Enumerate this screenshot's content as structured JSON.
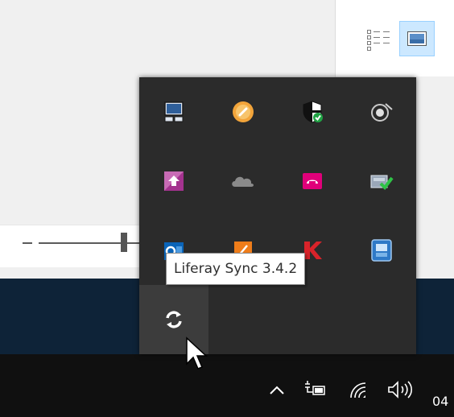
{
  "window": {
    "toolbar_buttons": [
      {
        "name": "details-view",
        "icon": "details-list-icon",
        "selected": false
      },
      {
        "name": "large-icons-view",
        "icon": "picture-frame-icon",
        "selected": true
      }
    ],
    "zoom_slider": {
      "value_fraction": 0.85
    }
  },
  "tray_overflow": {
    "icons": [
      {
        "icon": "touchpad-monitor-icon"
      },
      {
        "icon": "orange-disc-icon"
      },
      {
        "icon": "security-shield-check-icon"
      },
      {
        "icon": "speaker-icon"
      },
      {
        "icon": "purple-upload-icon"
      },
      {
        "icon": "onedrive-cloud-icon"
      },
      {
        "icon": "pink-phone-icon"
      },
      {
        "icon": "green-check-card-icon"
      },
      {
        "icon": "outlook-icon"
      },
      {
        "icon": "orange-app-icon"
      },
      {
        "icon": "red-k-icon"
      },
      {
        "icon": "blue-network-icon"
      },
      {
        "icon": "liferay-sync-icon",
        "hovered": true
      }
    ]
  },
  "tooltip": {
    "text": "Liferay Sync 3.4.2"
  },
  "taskbar": {
    "tray": [
      {
        "icon": "chevron-up-icon"
      },
      {
        "icon": "battery-plug-icon"
      },
      {
        "icon": "wifi-icon"
      },
      {
        "icon": "volume-icon"
      }
    ],
    "clock_partial": "04"
  },
  "colors": {
    "flyout_bg": "#2b2b2b",
    "taskbar_bg": "#101010",
    "selected_view_bg": "#cce8ff"
  }
}
